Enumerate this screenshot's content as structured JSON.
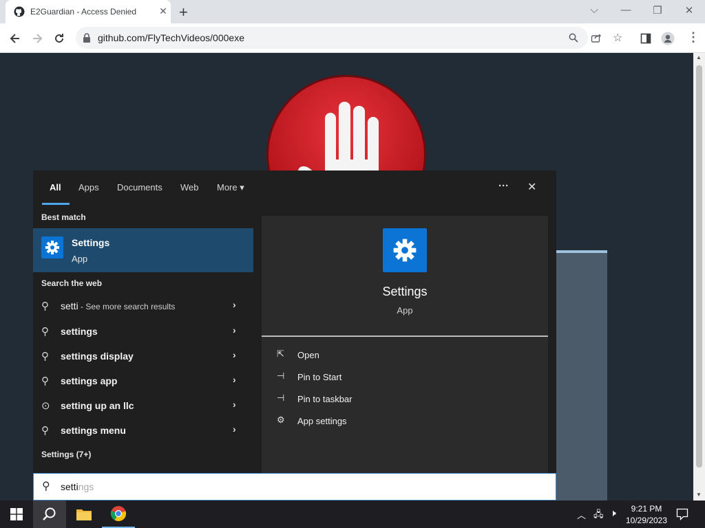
{
  "browser": {
    "tab_title": "E2Guardian - Access Denied",
    "tab_close": "✕",
    "new_tab": "+",
    "url": "github.com/FlyTechVideos/000exe",
    "window_controls": [
      "⌵",
      "—",
      "❐",
      "✕"
    ]
  },
  "search_panel": {
    "tabs": [
      "All",
      "Apps",
      "Documents",
      "Web",
      "More"
    ],
    "more_caret": "▾",
    "ellipsis": "···",
    "close": "✕",
    "best_match_header": "Best match",
    "best_match": {
      "title": "Settings",
      "subtitle": "App"
    },
    "search_web_header": "Search the web",
    "web_first": {
      "query": "setti",
      "suffix": " - See more search results"
    },
    "web_results": [
      "settings",
      "settings display",
      "settings app",
      "setting up an llc",
      "settings menu"
    ],
    "settings_header": "Settings (7+)",
    "preview": {
      "title": "Settings",
      "subtitle": "App"
    },
    "actions": [
      "Open",
      "Pin to Start",
      "Pin to taskbar",
      "App settings"
    ],
    "search_typed": "setti",
    "search_ghost": "ngs"
  },
  "taskbar": {
    "time": "9:21 PM",
    "date": "10/29/2023"
  },
  "colors": {
    "accent": "#0c74d4",
    "selected": "#1e4b6d",
    "panel": "#1f1f1f"
  }
}
